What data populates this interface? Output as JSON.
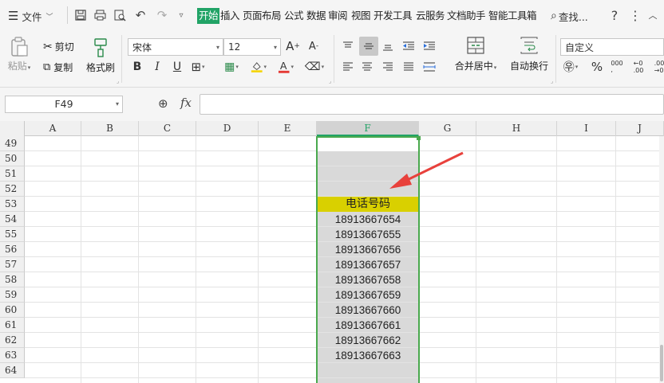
{
  "menu": {
    "file_label": "文件",
    "tabs": [
      {
        "label": "开始",
        "active": true
      },
      {
        "label": "插入"
      },
      {
        "label": "页面布局"
      },
      {
        "label": "公式"
      },
      {
        "label": "数据"
      },
      {
        "label": "审阅"
      },
      {
        "label": "视图"
      },
      {
        "label": "开发工具"
      },
      {
        "label": "云服务"
      },
      {
        "label": "文档助手"
      },
      {
        "label": "智能工具箱"
      }
    ],
    "search_label": "查找..."
  },
  "ribbon": {
    "paste_label": "粘贴",
    "cut_label": "剪切",
    "copy_label": "复制",
    "format_painter_label": "格式刷",
    "font_name": "宋体",
    "font_size": "12",
    "merge_center_label": "合并居中",
    "wrap_text_label": "自动换行",
    "number_format": "自定义"
  },
  "formula_bar": {
    "name_box": "F49",
    "fx_label": "fx",
    "formula": ""
  },
  "grid": {
    "columns": [
      "A",
      "B",
      "C",
      "D",
      "E",
      "F",
      "G",
      "H",
      "I",
      "J"
    ],
    "selected_column": "F",
    "rows": [
      "49",
      "50",
      "51",
      "52",
      "53",
      "54",
      "55",
      "56",
      "57",
      "58",
      "59",
      "60",
      "61",
      "62",
      "63",
      "64"
    ],
    "f_cells": [
      "",
      "",
      "",
      "",
      "电话号码",
      "18913667654",
      "18913667655",
      "18913667656",
      "18913667657",
      "18913667658",
      "18913667659",
      "18913667660",
      "18913667661",
      "18913667662",
      "18913667663",
      ""
    ]
  },
  "colors": {
    "accent": "#21a366",
    "selection": "#4aa94e",
    "header_fill": "#d9d000",
    "arrow": "#e8413c"
  }
}
